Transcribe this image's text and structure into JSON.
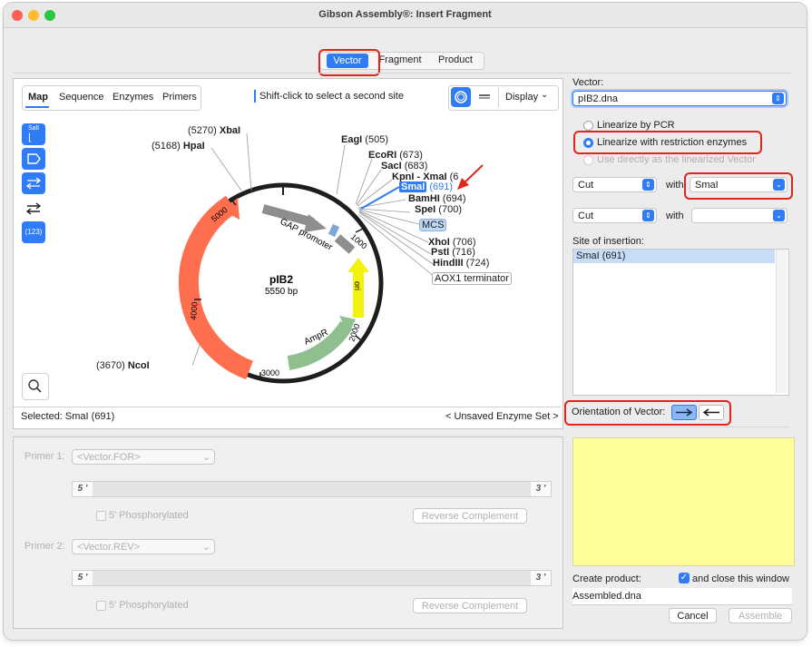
{
  "window": {
    "title": "Gibson Assembly®: Insert Fragment"
  },
  "mode_tabs": [
    "Vector",
    "Fragment",
    "Product"
  ],
  "map_panel": {
    "tabs": [
      "Map",
      "Sequence",
      "Enzymes",
      "Primers"
    ],
    "hint": "Shift-click to select a second site",
    "display_label": "Display",
    "tool_buttons": {
      "sali_label": "SalI",
      "numbers_label": "(123)"
    },
    "plasmid": {
      "name": "pIB2",
      "size": "5550 bp",
      "features": [
        "PpHIS4",
        "AmpR",
        "ori",
        "GAP promoter",
        "MCS",
        "AOX1 terminator"
      ],
      "ticks": [
        "1000",
        "2000",
        "3000",
        "4000",
        "5000"
      ],
      "sites": [
        {
          "name": "XbaI",
          "pos": "(5270)"
        },
        {
          "name": "HpaI",
          "pos": "(5168)"
        },
        {
          "name": "EagI",
          "pos": "(505)"
        },
        {
          "name": "EcoRI",
          "pos": "(673)"
        },
        {
          "name": "SacI",
          "pos": "(683)"
        },
        {
          "name": "KpnI - XmaI",
          "pos": "(6"
        },
        {
          "name": "SmaI",
          "pos": "(691)"
        },
        {
          "name": "BamHI",
          "pos": "(694)"
        },
        {
          "name": "SpeI",
          "pos": "(700)"
        },
        {
          "name": "XhoI",
          "pos": "(706)"
        },
        {
          "name": "PstI",
          "pos": "(716)"
        },
        {
          "name": "HindIII",
          "pos": "(724)"
        },
        {
          "name": "NcoI",
          "pos": "(3670)"
        }
      ]
    },
    "status_selected": "Selected:  SmaI (691)",
    "enzyme_set": "< Unsaved Enzyme Set >"
  },
  "vector_panel": {
    "vector_label": "Vector:",
    "vector_file": "pIB2.dna",
    "option_pcr": "Linearize by PCR",
    "option_restriction": "Linearize with restriction enzymes",
    "option_direct": "Use directly as the linearized Vector",
    "cut1": "Cut",
    "with1": "with",
    "enzyme1": "SmaI",
    "cut2": "Cut",
    "with2": "with",
    "enzyme2": "",
    "site_label": "Site of insertion:",
    "site_item": "SmaI   (691)",
    "orientation_label": "Orientation of Vector:"
  },
  "primers": {
    "primer1_label": "Primer 1:",
    "primer1_value": "<Vector.FOR>",
    "primer2_label": "Primer 2:",
    "primer2_value": "<Vector.REV>",
    "five_prime": "5 '",
    "three_prime": "3 '",
    "phos_label": "5' Phosphorylated",
    "revcomp_label": "Reverse Complement"
  },
  "product": {
    "create_label": "Create product:",
    "close_label": "and close this window",
    "filename": "Assembled.dna",
    "cancel": "Cancel",
    "assemble": "Assemble"
  },
  "colors": {
    "accent": "#2f7cf6",
    "highlight": "#e0261b",
    "notes": "#ffff99"
  }
}
